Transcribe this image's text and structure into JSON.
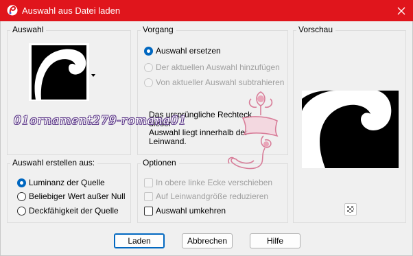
{
  "window": {
    "title": "Auswahl aus Datei laden"
  },
  "auswahl_group": {
    "label": "Auswahl"
  },
  "vorgang_group": {
    "label": "Vorgang",
    "options": [
      {
        "label": "Auswahl ersetzen",
        "checked": true,
        "enabled": true
      },
      {
        "label": "Der aktuellen Auswahl hinzufügen",
        "checked": false,
        "enabled": false
      },
      {
        "label": "Von aktueller Auswahl subtrahieren",
        "checked": false,
        "enabled": false
      }
    ],
    "info_line1": "Das ursprüngliche Rechteck dieser",
    "info_line2": "Auswahl liegt innerhalb der",
    "info_line3": "Leinwand."
  },
  "vorschau_group": {
    "label": "Vorschau"
  },
  "erstellen_group": {
    "label": "Auswahl erstellen aus:",
    "options": [
      {
        "label": "Luminanz der Quelle",
        "checked": true
      },
      {
        "label": "Beliebiger Wert außer Null",
        "checked": false
      },
      {
        "label": "Deckfähigkeit der Quelle",
        "checked": false
      }
    ]
  },
  "optionen_group": {
    "label": "Optionen",
    "checkboxes": [
      {
        "label": "In obere linke Ecke verschieben",
        "checked": false,
        "enabled": false
      },
      {
        "label": "Auf Leinwandgröße reduzieren",
        "checked": false,
        "enabled": false
      },
      {
        "label": "Auswahl umkehren",
        "checked": false,
        "enabled": true
      }
    ]
  },
  "buttons": {
    "load": "Laden",
    "cancel": "Abbrechen",
    "help": "Hilfe"
  },
  "overlay": {
    "filename": "01ornament279-romana01"
  },
  "colors": {
    "titlebar": "#e0151c",
    "accent": "#0067c0",
    "watermark": "#d46a8a"
  }
}
